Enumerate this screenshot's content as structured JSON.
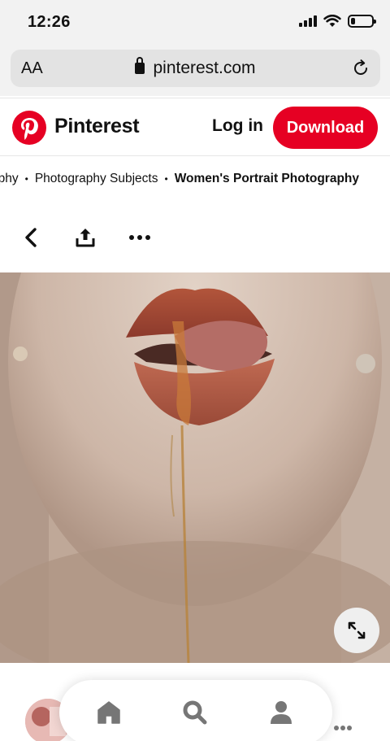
{
  "status_bar": {
    "time": "12:26"
  },
  "address_bar": {
    "text_size_label": "AA",
    "url": "pinterest.com"
  },
  "header": {
    "brand": "Pinterest",
    "login_label": "Log in",
    "download_label": "Download",
    "brand_color": "#e60023"
  },
  "breadcrumb": {
    "items": [
      "aphy",
      "Photography Subjects",
      "Women's Portrait Photography"
    ],
    "separator": "•"
  },
  "actions": {
    "icons": [
      "back-arrow-icon",
      "share-icon",
      "more-options-icon"
    ]
  },
  "pin": {
    "image": "close-up of lips with dripping honey"
  },
  "bottom_nav": {
    "icons": [
      "home-icon",
      "search-icon",
      "profile-icon",
      "more-dots-icon"
    ]
  }
}
